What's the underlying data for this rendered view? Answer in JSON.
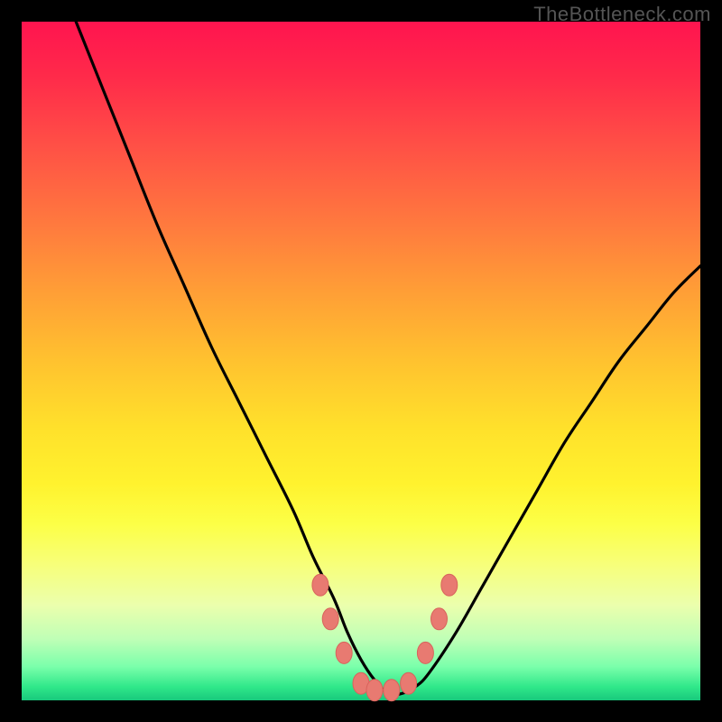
{
  "watermark": "TheBottleneck.com",
  "colors": {
    "frame": "#000000",
    "curve": "#000000",
    "marker_fill": "#e87a71",
    "marker_stroke": "#d8635c"
  },
  "chart_data": {
    "type": "line",
    "title": "",
    "xlabel": "",
    "ylabel": "",
    "xlim": [
      0,
      100
    ],
    "ylim": [
      0,
      100
    ],
    "grid": false,
    "legend_position": "none",
    "series": [
      {
        "name": "bottleneck-curve",
        "x": [
          8,
          12,
          16,
          20,
          24,
          28,
          32,
          36,
          40,
          43,
          46,
          48,
          50,
          52,
          54,
          56,
          58,
          60,
          64,
          68,
          72,
          76,
          80,
          84,
          88,
          92,
          96,
          100
        ],
        "y": [
          100,
          90,
          80,
          70,
          61,
          52,
          44,
          36,
          28,
          21,
          15,
          10,
          6,
          3,
          1,
          1,
          2,
          4,
          10,
          17,
          24,
          31,
          38,
          44,
          50,
          55,
          60,
          64
        ]
      }
    ],
    "markers": [
      {
        "x": 44.0,
        "y": 17
      },
      {
        "x": 45.5,
        "y": 12
      },
      {
        "x": 47.5,
        "y": 7
      },
      {
        "x": 50.0,
        "y": 2.5
      },
      {
        "x": 52.0,
        "y": 1.5
      },
      {
        "x": 54.5,
        "y": 1.5
      },
      {
        "x": 57.0,
        "y": 2.5
      },
      {
        "x": 59.5,
        "y": 7
      },
      {
        "x": 61.5,
        "y": 12
      },
      {
        "x": 63.0,
        "y": 17
      }
    ],
    "annotations": [
      {
        "text": "TheBottleneck.com",
        "pos": "top-right"
      }
    ]
  }
}
